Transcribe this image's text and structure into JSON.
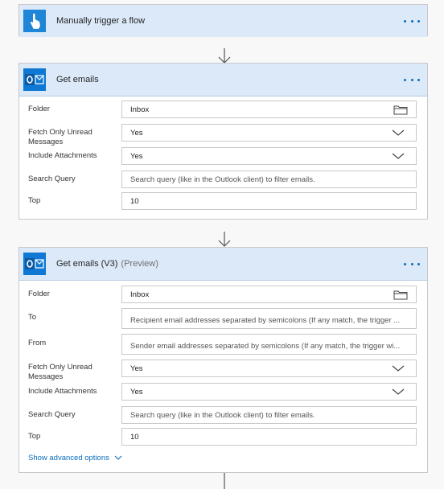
{
  "trigger": {
    "title": "Manually trigger a flow",
    "icon": "hand-pointer-icon"
  },
  "get_emails": {
    "title": "Get emails",
    "icon": "outlook-icon",
    "fields": [
      {
        "label": "Folder",
        "value": "Inbox",
        "kind": "folder"
      },
      {
        "label": "Fetch Only Unread Messages",
        "value": "Yes",
        "kind": "dropdown"
      },
      {
        "label": "Include Attachments",
        "value": "Yes",
        "kind": "dropdown"
      },
      {
        "label": "Search Query",
        "placeholder": "Search query (like in the Outlook client) to filter emails.",
        "kind": "text"
      },
      {
        "label": "Top",
        "value": "10",
        "kind": "text"
      }
    ]
  },
  "get_emails_v3": {
    "title": "Get emails (V3)",
    "tag": "(Preview)",
    "icon": "outlook-icon",
    "fields": [
      {
        "label": "Folder",
        "value": "Inbox",
        "kind": "folder"
      },
      {
        "label": "To",
        "placeholder": "Recipient email addresses separated by semicolons (If any match, the trigger ...",
        "kind": "text"
      },
      {
        "label": "From",
        "placeholder": "Sender email addresses separated by semicolons (If any match, the trigger wi...",
        "kind": "text"
      },
      {
        "label": "Fetch Only Unread Messages",
        "value": "Yes",
        "kind": "dropdown"
      },
      {
        "label": "Include Attachments",
        "value": "Yes",
        "kind": "dropdown"
      },
      {
        "label": "Search Query",
        "placeholder": "Search query (like in the Outlook client) to filter emails.",
        "kind": "text"
      },
      {
        "label": "Top",
        "value": "10",
        "kind": "text"
      }
    ],
    "advanced_label": "Show advanced options"
  },
  "colors": {
    "accent": "#0b6cbd",
    "header_bg": "#dbe9f8",
    "trigger_icon_bg": "#1f85d6",
    "outlook_blue": "#0f78d4"
  }
}
